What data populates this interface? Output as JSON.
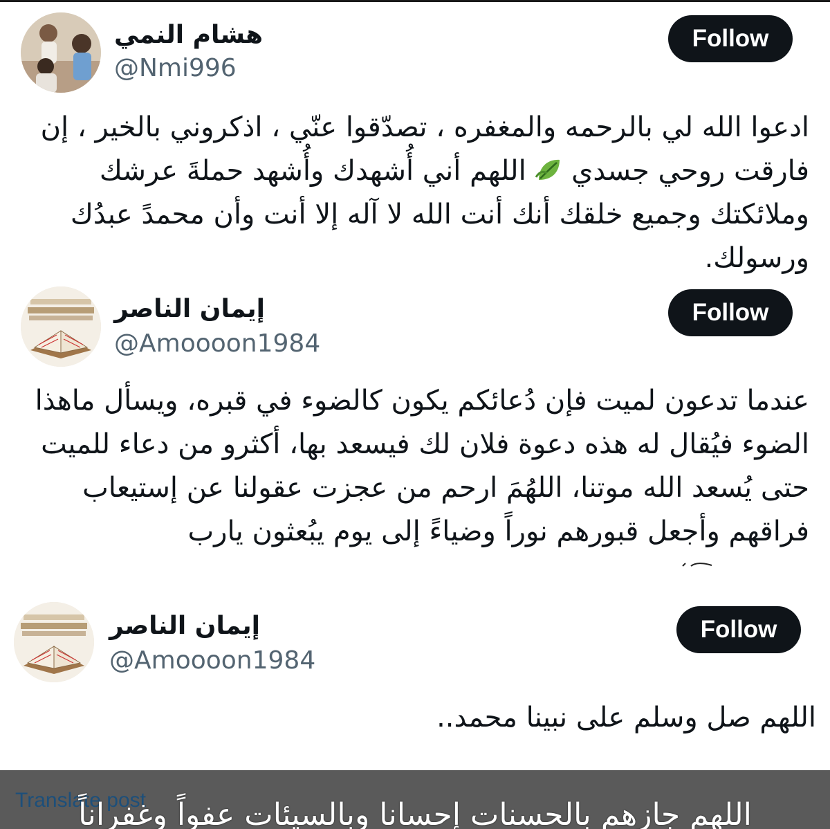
{
  "posts": [
    {
      "name": "هشام النمي",
      "handle": "@Nmi996",
      "follow_label": "Follow",
      "text_before_icon": "ادعوا الله لي بالرحمه والمغفره ، تصدّقوا عنّي ، اذكروني بالخير ، إن\nفارقت روحي جسدي ",
      "icon": "leaf-emoji",
      "text_after_icon": " اللهم أني أُشهدك وأُشهد حملةَ عرشك\nوملائكتك وجميع خلقك أنك أنت الله لا آله إلا أنت وأن محمدً عبدُك\nورسولك."
    },
    {
      "name": "إيمان الناصر",
      "handle": "@Amoooon1984",
      "follow_label": "Follow",
      "text": "عندما تدعون لميت فإن دُعائكم يكون كالضوء في قبره، ويسأل ماهذا\nالضوء فيُقال له هذه دعوة فلان لك فيسعد بها، أكثرو من دعاء للميت\nحتى يُسعد الله موتنا، اللهُمَ ارحم من عجزت عقولنا عن إستيعاب\nفراقهم وأجعل قبورهم نوراً وضياءً إلى يوم يبُعثون يارب"
    },
    {
      "name": "إيمان الناصر",
      "handle": "@Amoooon1984",
      "follow_label": "Follow",
      "text": "اللهم صل وسلم على نبينا محمد.."
    }
  ],
  "footer": {
    "translate_label": "Translate post",
    "caption": "اللهم جازهم بالحسنات إحسانا وبالسيئات عفواً وغفراناً"
  },
  "colors": {
    "follow_bg": "#0f1419",
    "handle": "#536471",
    "overlay": "#5a5a5a",
    "translate": "#1d4f7a"
  }
}
